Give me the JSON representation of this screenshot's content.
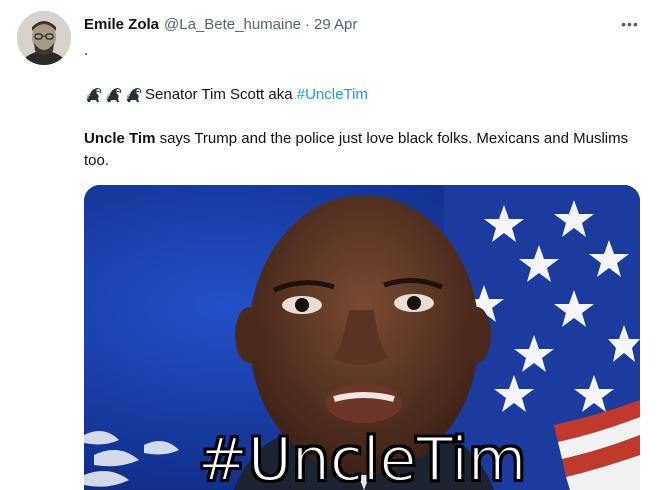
{
  "tweet": {
    "author_name": "Emile Zola",
    "handle": "@La_Bete_humaine",
    "separator": "·",
    "date": "29 Apr",
    "more_icon": "more-horizontal-icon",
    "line1": ".",
    "emoji": [
      "skunk-emoji",
      "skunk-emoji",
      "skunk-emoji"
    ],
    "line2_text": "Senator Tim Scott aka ",
    "line2_hashtag": "#UncleTim",
    "para_bold": "Uncle Tim",
    "para_rest": " says Trump and the police just love black folks. Mexicans and Muslims too.",
    "media": {
      "overlay_text": "#UncleTim",
      "flag_colors": {
        "field": "#1a3fa8",
        "stripe_red": "#c0392b",
        "stripe_white": "#f2f2f2"
      }
    }
  },
  "colors": {
    "link": "#1d9bf0",
    "secondary_text": "#536471",
    "primary_text": "#0f1419"
  }
}
